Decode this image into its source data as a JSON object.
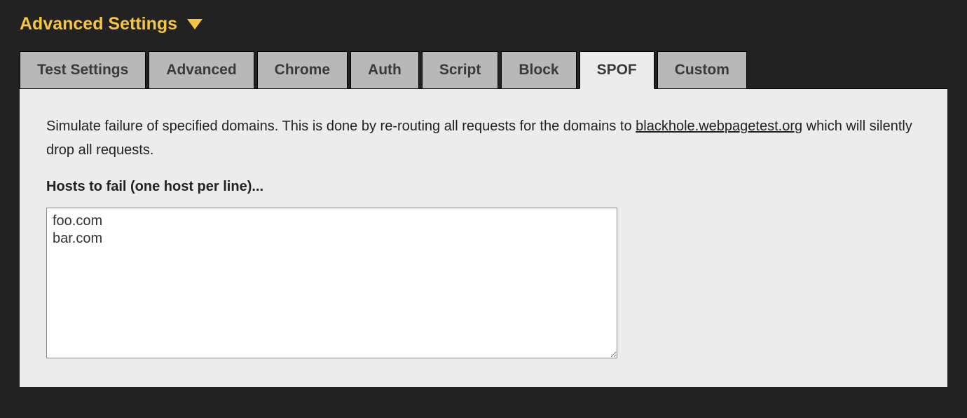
{
  "header": {
    "title": "Advanced Settings"
  },
  "tabs": [
    {
      "label": "Test Settings",
      "active": false
    },
    {
      "label": "Advanced",
      "active": false
    },
    {
      "label": "Chrome",
      "active": false
    },
    {
      "label": "Auth",
      "active": false
    },
    {
      "label": "Script",
      "active": false
    },
    {
      "label": "Block",
      "active": false
    },
    {
      "label": "SPOF",
      "active": true
    },
    {
      "label": "Custom",
      "active": false
    }
  ],
  "spof_panel": {
    "description_pre": "Simulate failure of specified domains. This is done by re-routing all requests for the domains to ",
    "description_link": "blackhole.webpagetest.org",
    "description_post": " which will silently drop all requests.",
    "field_label": "Hosts to fail (one host per line)...",
    "hosts_value": "foo.com\nbar.com"
  }
}
